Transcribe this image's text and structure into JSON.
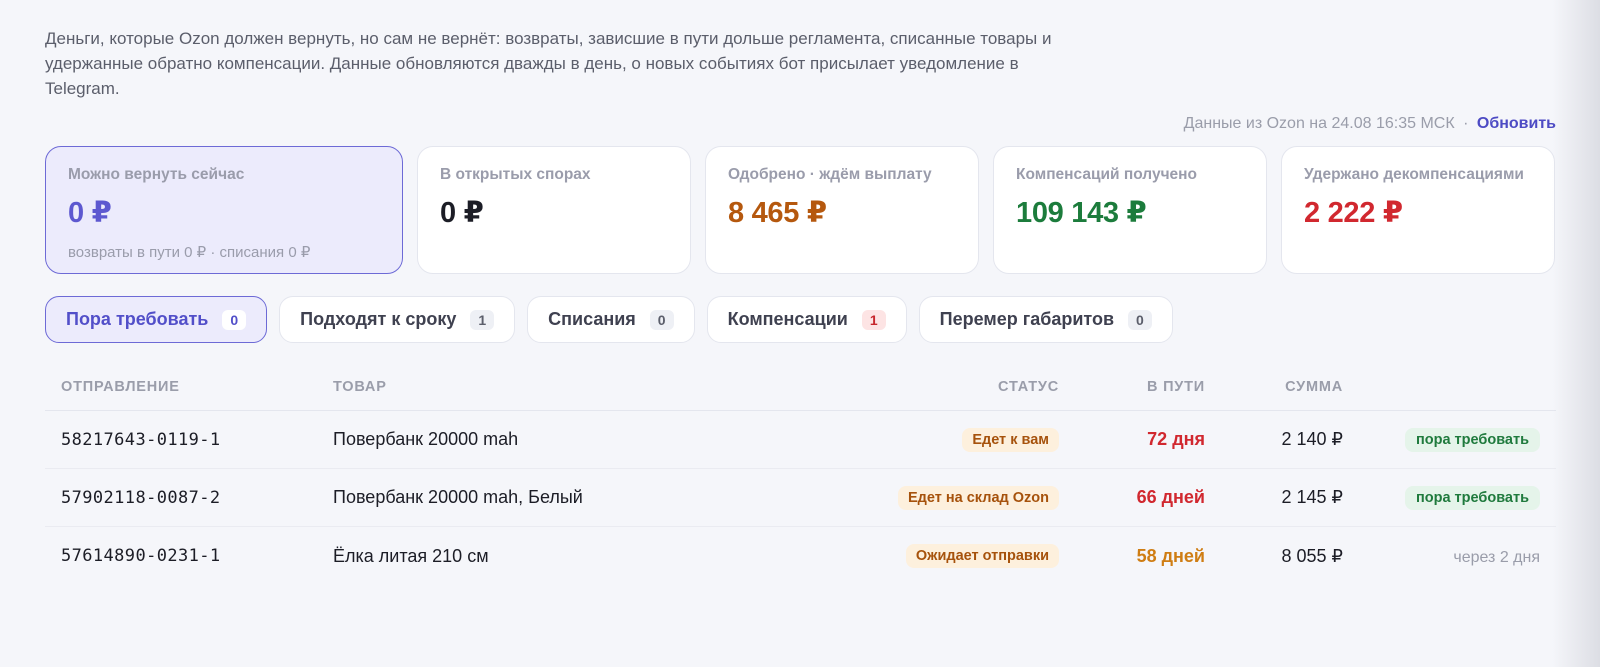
{
  "intro": {
    "text": "Деньги, которые Ozon должен вернуть, но сам не вернёт: возвраты, зависшие в пути дольше регламента, списанные товары и удержанные обратно компенсации. Данные обновляются дважды в день, о новых событиях бот присылает уведомление в Telegram."
  },
  "updated": {
    "text": "Данные из Ozon на 24.08 16:35 МСК",
    "separator": "·",
    "refresh_label": "Обновить"
  },
  "cards": [
    {
      "label": "Можно вернуть сейчас",
      "value": "0 ₽",
      "sub": "возвраты в пути 0 ₽ · списания 0 ₽",
      "color": "#5d58d0"
    },
    {
      "label": "В открытых спорах",
      "value": "0 ₽",
      "color": "#1c1d26"
    },
    {
      "label": "Одобрено · ждём выплату",
      "value": "8 465 ₽",
      "color": "#b5580e"
    },
    {
      "label": "Компенсаций получено",
      "value": "109 143 ₽",
      "color": "#1c7c3c"
    },
    {
      "label": "Удержано декомпенсациями",
      "value": "2 222 ₽",
      "color": "#d1282f"
    }
  ],
  "tabs": [
    {
      "label": "Пора требовать",
      "count": "0",
      "active": true
    },
    {
      "label": "Подходят к сроку",
      "count": "1"
    },
    {
      "label": "Списания",
      "count": "0"
    },
    {
      "label": "Компенсации",
      "count": "1",
      "highlight": "red"
    },
    {
      "label": "Перемер габаритов",
      "count": "0"
    }
  ],
  "table": {
    "headers": {
      "shipment": "ОТПРАВЛЕНИЕ",
      "product": "ТОВАР",
      "status": "СТАТУС",
      "in_transit": "В ПУТИ",
      "sum": "СУММА"
    },
    "rows": [
      {
        "shipment": "58217643-0119-1",
        "product": "Повербанк 20000 mah",
        "status": "Едет к вам",
        "days": "72 дня",
        "days_color": "red",
        "sum": "2 140 ₽",
        "action": "пора требовать",
        "action_type": "pill"
      },
      {
        "shipment": "57902118-0087-2",
        "product": "Повербанк 20000 mah, Белый",
        "status": "Едет на склад Ozon",
        "days": "66 дней",
        "days_color": "red",
        "sum": "2 145 ₽",
        "action": "пора требовать",
        "action_type": "pill"
      },
      {
        "shipment": "57614890-0231-1",
        "product": "Ёлка литая 210 см",
        "status": "Ожидает отправки",
        "days": "58 дней",
        "days_color": "orange",
        "sum": "8 055 ₽",
        "action": "через 2 дня",
        "action_type": "muted"
      }
    ]
  }
}
